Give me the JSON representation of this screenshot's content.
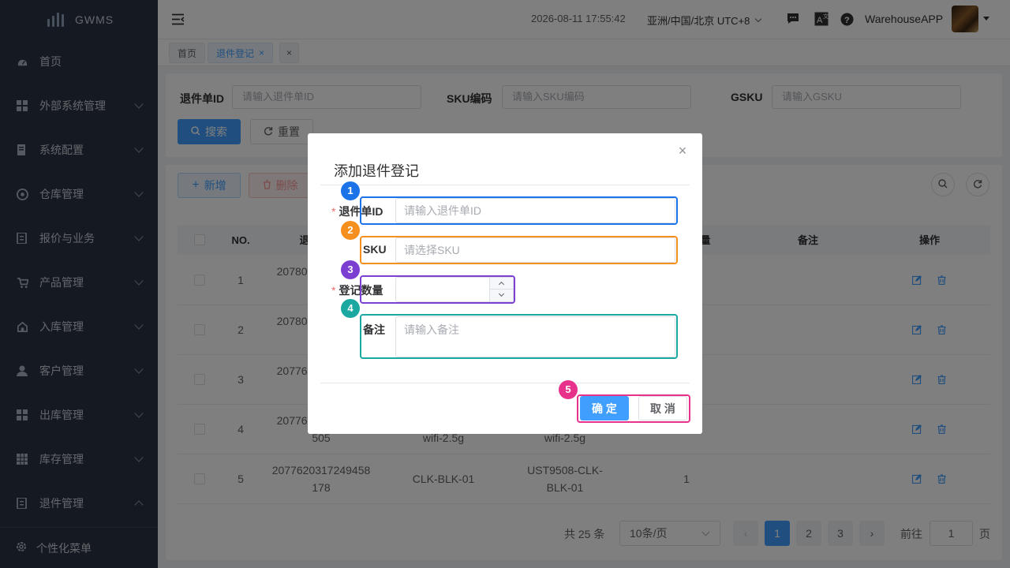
{
  "app": {
    "name": "GWMS"
  },
  "sidebar": {
    "items": [
      {
        "label": "首页",
        "icon": "dashboard-icon"
      },
      {
        "label": "外部系统管理",
        "icon": "grid-icon"
      },
      {
        "label": "系统配置",
        "icon": "config-icon"
      },
      {
        "label": "仓库管理",
        "icon": "warehouse-icon"
      },
      {
        "label": "报价与业务",
        "icon": "quote-icon"
      },
      {
        "label": "产品管理",
        "icon": "cart-icon"
      },
      {
        "label": "入库管理",
        "icon": "inbound-icon"
      },
      {
        "label": "客户管理",
        "icon": "user-icon"
      },
      {
        "label": "出库管理",
        "icon": "grid-icon"
      },
      {
        "label": "库存管理",
        "icon": "table-icon"
      },
      {
        "label": "退件管理",
        "icon": "return-icon"
      }
    ],
    "footer": "个性化菜单"
  },
  "header": {
    "datetime": "2026-08-11 17:55:42",
    "timezone": "亚洲/中国/北京 UTC+8",
    "user": "WarehouseAPP"
  },
  "tags": [
    {
      "label": "首页"
    },
    {
      "label": "退件登记"
    }
  ],
  "search": {
    "return_id_label": "退件单ID",
    "return_id_placeholder": "请输入退件单ID",
    "sku_label": "SKU编码",
    "sku_placeholder": "请输入SKU编码",
    "gsku_label": "GSKU",
    "gsku_placeholder": "请输入GSKU",
    "search_btn": "搜索",
    "reset_btn": "重置"
  },
  "toolbar": {
    "add_btn": "新增",
    "delete_btn": "删除"
  },
  "table": {
    "headers": {
      "no": "NO.",
      "col1": "退",
      "col4": "量",
      "remark": "备注",
      "actions": "操作"
    },
    "rows": [
      {
        "no": "1",
        "id": "207805"
      },
      {
        "no": "2",
        "id": "207805"
      },
      {
        "no": "3",
        "id": "207766"
      },
      {
        "no": "4",
        "id": "207766",
        "id2": "505",
        "sku": "wifi-2.5g",
        "gsku": "wifi-2.5g"
      },
      {
        "no": "5",
        "id": "2077620317249458",
        "id2": "178",
        "sku": "CLK-BLK-01",
        "gsku": "UST9508-CLK-",
        "gsku2": "BLK-01",
        "qty": "1"
      }
    ]
  },
  "pagination": {
    "total": "共 25 条",
    "size": "10条/页",
    "pages": [
      "1",
      "2",
      "3"
    ],
    "goto_label": "前往",
    "goto_value": "1",
    "page_suffix": "页"
  },
  "dialog": {
    "title": "添加退件登记",
    "fields": {
      "return_id": {
        "label": "退件单ID",
        "placeholder": "请输入退件单ID",
        "badge": "1"
      },
      "sku": {
        "label": "SKU",
        "placeholder": "请选择SKU",
        "badge": "2"
      },
      "qty": {
        "label": "登记数量",
        "value": "",
        "badge": "3"
      },
      "remark": {
        "label": "备注",
        "placeholder": "请输入备注",
        "badge": "4"
      }
    },
    "confirm": "确 定",
    "cancel": "取 消",
    "buttons_badge": "5"
  },
  "colors": {
    "primary": "#409eff",
    "badge1": "#1a73e8",
    "badge2": "#f5901e",
    "badge3": "#7b3fd1",
    "badge4": "#1aa8a0",
    "badge5": "#e8318a"
  }
}
